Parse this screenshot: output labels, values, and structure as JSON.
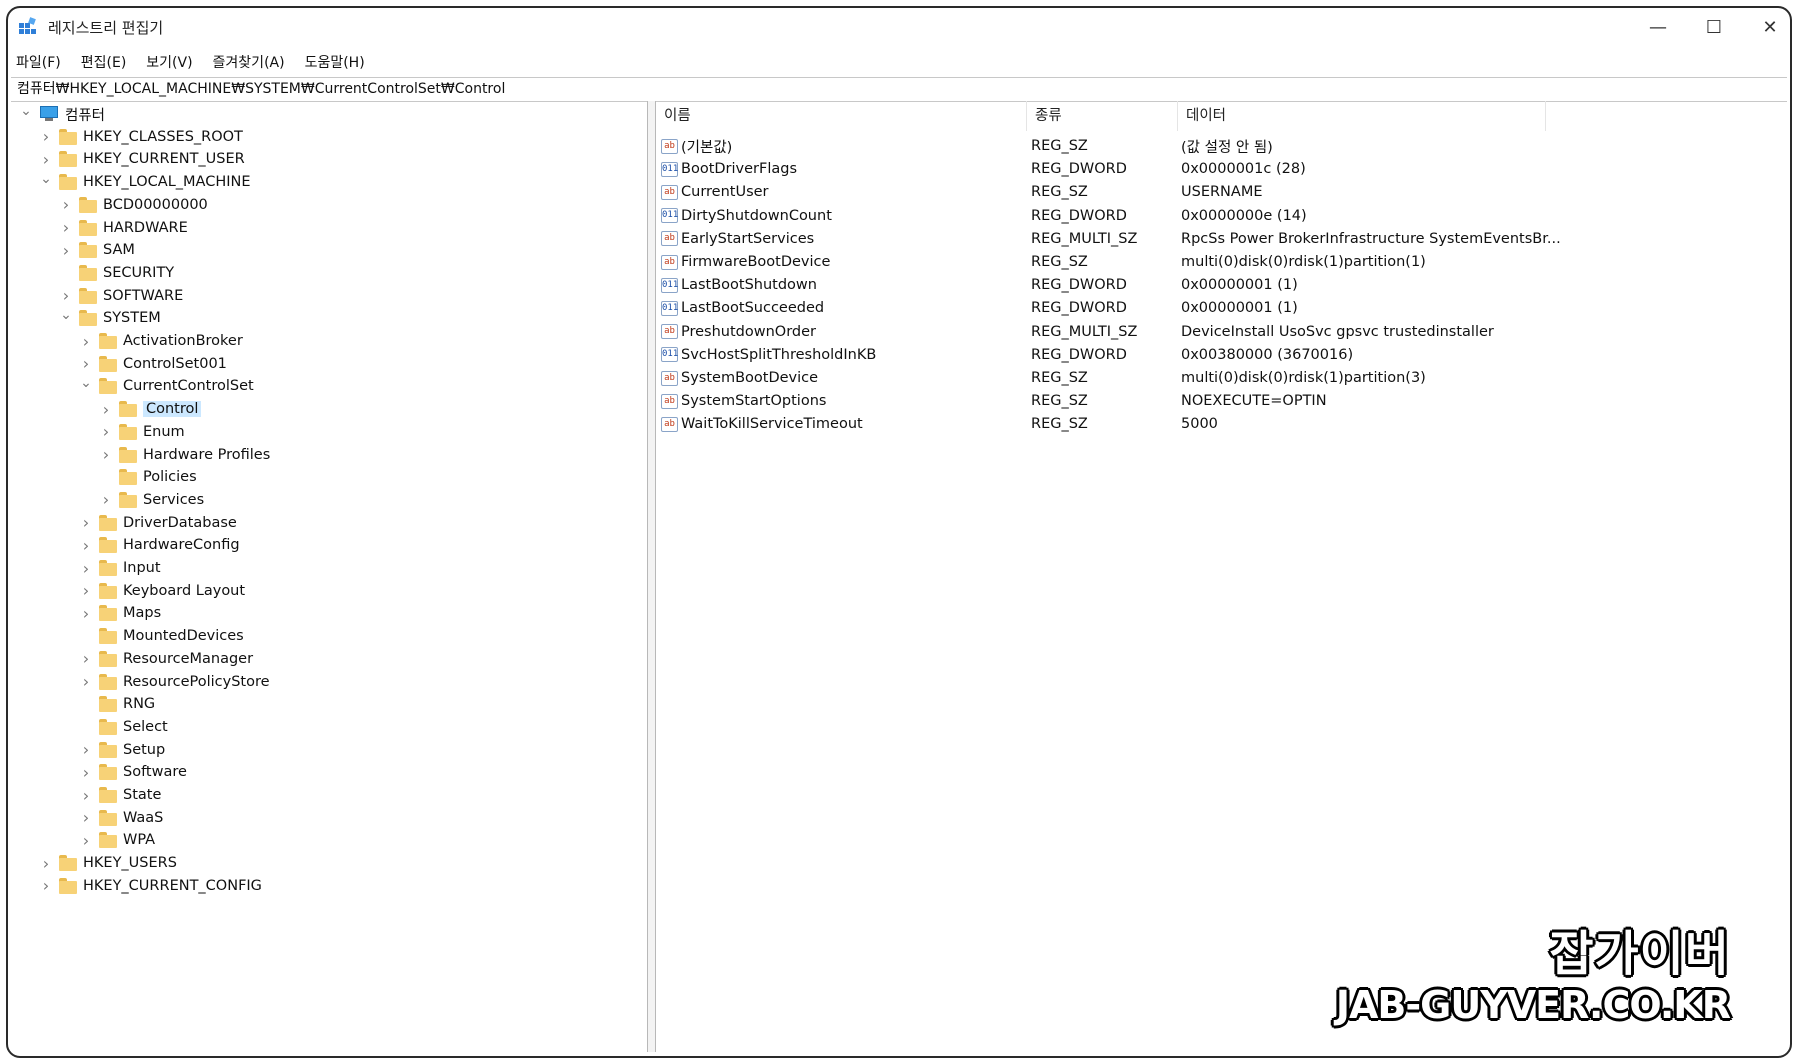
{
  "window": {
    "title": "레지스트리 편집기",
    "minimize": "—",
    "maximize": "☐",
    "close": "✕"
  },
  "menu": [
    "파일(F)",
    "편집(E)",
    "보기(V)",
    "즐겨찾기(A)",
    "도움말(H)"
  ],
  "address": "컴퓨터₩HKEY_LOCAL_MACHINE₩SYSTEM₩CurrentControlSet₩Control",
  "tree": [
    {
      "label": "컴퓨터",
      "level": 0,
      "expander": "open",
      "icon": "computer-icon"
    },
    {
      "label": "HKEY_CLASSES_ROOT",
      "level": 1,
      "expander": "closed",
      "icon": "folder-icon"
    },
    {
      "label": "HKEY_CURRENT_USER",
      "level": 1,
      "expander": "closed",
      "icon": "folder-icon"
    },
    {
      "label": "HKEY_LOCAL_MACHINE",
      "level": 1,
      "expander": "open",
      "icon": "folder-icon"
    },
    {
      "label": "BCD00000000",
      "level": 2,
      "expander": "closed",
      "icon": "folder-icon"
    },
    {
      "label": "HARDWARE",
      "level": 2,
      "expander": "closed",
      "icon": "folder-icon"
    },
    {
      "label": "SAM",
      "level": 2,
      "expander": "closed",
      "icon": "folder-icon"
    },
    {
      "label": "SECURITY",
      "level": 2,
      "expander": "none",
      "icon": "folder-icon"
    },
    {
      "label": "SOFTWARE",
      "level": 2,
      "expander": "closed",
      "icon": "folder-icon"
    },
    {
      "label": "SYSTEM",
      "level": 2,
      "expander": "open",
      "icon": "folder-icon"
    },
    {
      "label": "ActivationBroker",
      "level": 3,
      "expander": "closed",
      "icon": "folder-icon"
    },
    {
      "label": "ControlSet001",
      "level": 3,
      "expander": "closed",
      "icon": "folder-icon"
    },
    {
      "label": "CurrentControlSet",
      "level": 3,
      "expander": "open",
      "icon": "folder-icon"
    },
    {
      "label": "Control",
      "level": 4,
      "expander": "closed",
      "icon": "folder-icon",
      "selected": true
    },
    {
      "label": "Enum",
      "level": 4,
      "expander": "closed",
      "icon": "folder-icon"
    },
    {
      "label": "Hardware Profiles",
      "level": 4,
      "expander": "closed",
      "icon": "folder-icon"
    },
    {
      "label": "Policies",
      "level": 4,
      "expander": "none",
      "icon": "folder-icon"
    },
    {
      "label": "Services",
      "level": 4,
      "expander": "closed",
      "icon": "folder-icon"
    },
    {
      "label": "DriverDatabase",
      "level": 3,
      "expander": "closed",
      "icon": "folder-icon"
    },
    {
      "label": "HardwareConfig",
      "level": 3,
      "expander": "closed",
      "icon": "folder-icon"
    },
    {
      "label": "Input",
      "level": 3,
      "expander": "closed",
      "icon": "folder-icon"
    },
    {
      "label": "Keyboard Layout",
      "level": 3,
      "expander": "closed",
      "icon": "folder-icon"
    },
    {
      "label": "Maps",
      "level": 3,
      "expander": "closed",
      "icon": "folder-icon"
    },
    {
      "label": "MountedDevices",
      "level": 3,
      "expander": "none",
      "icon": "folder-icon"
    },
    {
      "label": "ResourceManager",
      "level": 3,
      "expander": "closed",
      "icon": "folder-icon"
    },
    {
      "label": "ResourcePolicyStore",
      "level": 3,
      "expander": "closed",
      "icon": "folder-icon"
    },
    {
      "label": "RNG",
      "level": 3,
      "expander": "none",
      "icon": "folder-icon"
    },
    {
      "label": "Select",
      "level": 3,
      "expander": "none",
      "icon": "folder-icon"
    },
    {
      "label": "Setup",
      "level": 3,
      "expander": "closed",
      "icon": "folder-icon"
    },
    {
      "label": "Software",
      "level": 3,
      "expander": "closed",
      "icon": "folder-icon"
    },
    {
      "label": "State",
      "level": 3,
      "expander": "closed",
      "icon": "folder-icon"
    },
    {
      "label": "WaaS",
      "level": 3,
      "expander": "closed",
      "icon": "folder-icon"
    },
    {
      "label": "WPA",
      "level": 3,
      "expander": "closed",
      "icon": "folder-icon"
    },
    {
      "label": "HKEY_USERS",
      "level": 1,
      "expander": "closed",
      "icon": "folder-icon"
    },
    {
      "label": "HKEY_CURRENT_CONFIG",
      "level": 1,
      "expander": "closed",
      "icon": "folder-icon"
    }
  ],
  "columns": {
    "name": "이름",
    "type": "종류",
    "data": "데이터"
  },
  "values": [
    {
      "icon": "ab",
      "name": "(기본값)",
      "type": "REG_SZ",
      "data": "(값 설정 안 됨)"
    },
    {
      "icon": "bin",
      "name": "BootDriverFlags",
      "type": "REG_DWORD",
      "data": "0x0000001c (28)"
    },
    {
      "icon": "ab",
      "name": "CurrentUser",
      "type": "REG_SZ",
      "data": "USERNAME"
    },
    {
      "icon": "bin",
      "name": "DirtyShutdownCount",
      "type": "REG_DWORD",
      "data": "0x0000000e (14)"
    },
    {
      "icon": "ab",
      "name": "EarlyStartServices",
      "type": "REG_MULTI_SZ",
      "data": "RpcSs Power BrokerInfrastructure SystemEventsBr..."
    },
    {
      "icon": "ab",
      "name": "FirmwareBootDevice",
      "type": "REG_SZ",
      "data": "multi(0)disk(0)rdisk(1)partition(1)"
    },
    {
      "icon": "bin",
      "name": "LastBootShutdown",
      "type": "REG_DWORD",
      "data": "0x00000001 (1)"
    },
    {
      "icon": "bin",
      "name": "LastBootSucceeded",
      "type": "REG_DWORD",
      "data": "0x00000001 (1)"
    },
    {
      "icon": "ab",
      "name": "PreshutdownOrder",
      "type": "REG_MULTI_SZ",
      "data": "DeviceInstall UsoSvc gpsvc trustedinstaller"
    },
    {
      "icon": "bin",
      "name": "SvcHostSplitThresholdInKB",
      "type": "REG_DWORD",
      "data": "0x00380000 (3670016)"
    },
    {
      "icon": "ab",
      "name": "SystemBootDevice",
      "type": "REG_SZ",
      "data": "multi(0)disk(0)rdisk(1)partition(3)"
    },
    {
      "icon": "ab",
      "name": "SystemStartOptions",
      "type": "REG_SZ",
      "data": " NOEXECUTE=OPTIN"
    },
    {
      "icon": "ab",
      "name": "WaitToKillServiceTimeout",
      "type": "REG_SZ",
      "data": "5000"
    }
  ],
  "icon_glyphs": {
    "ab": "ab",
    "bin": "011"
  },
  "watermark": {
    "line1": "잡가이버",
    "line2": "JAB-GUYVER.CO.KR"
  }
}
